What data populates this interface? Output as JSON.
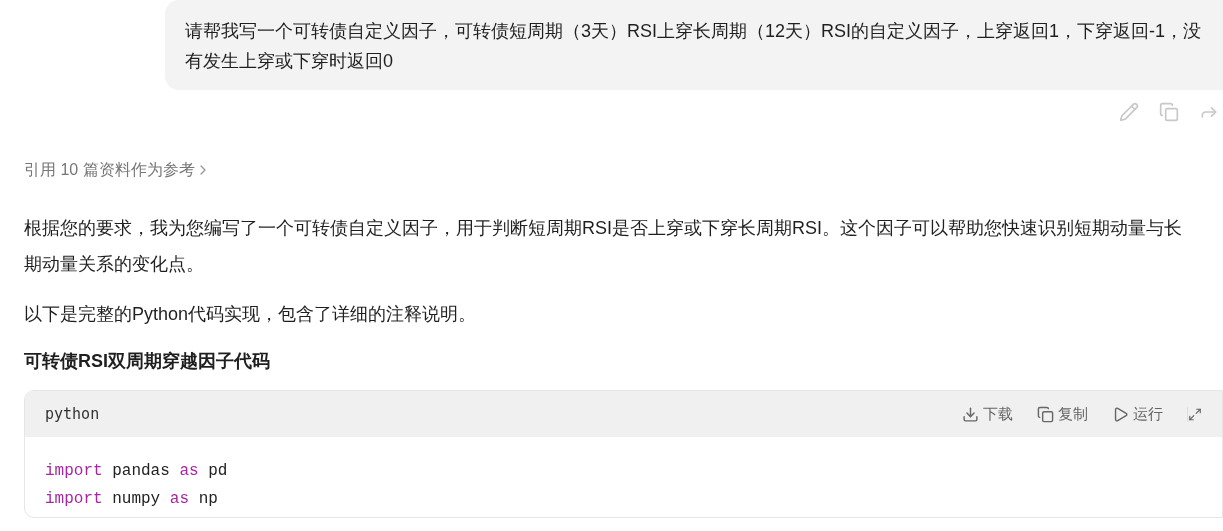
{
  "user_message": {
    "text": "请帮我写一个可转债自定义因子，可转债短周期（3天）RSI上穿长周期（12天）RSI的自定义因子，上穿返回1，下穿返回-1，没有发生上穿或下穿时返回0"
  },
  "references": {
    "text": "引用 10 篇资料作为参考"
  },
  "paragraphs": [
    "根据您的要求，我为您编写了一个可转债自定义因子，用于判断短周期RSI是否上穿或下穿长周期RSI。这个因子可以帮助您快速识别短期动量与长期动量关系的变化点。",
    "以下是完整的Python代码实现，包含了详细的注释说明。"
  ],
  "heading": "可转债RSI双周期穿越因子代码",
  "code": {
    "language": "python",
    "actions": [
      {
        "kind": "download",
        "label": "下载"
      },
      {
        "kind": "copy",
        "label": "复制"
      },
      {
        "kind": "run",
        "label": "运行"
      }
    ],
    "lines": [
      [
        {
          "text": "import",
          "kind": "keyword"
        },
        {
          "text": " pandas ",
          "kind": "plain"
        },
        {
          "text": "as",
          "kind": "keyword"
        },
        {
          "text": " pd",
          "kind": "plain"
        }
      ],
      [
        {
          "text": "import",
          "kind": "keyword"
        },
        {
          "text": " numpy ",
          "kind": "plain"
        },
        {
          "text": "as",
          "kind": "keyword"
        },
        {
          "text": " np",
          "kind": "plain"
        }
      ]
    ]
  }
}
